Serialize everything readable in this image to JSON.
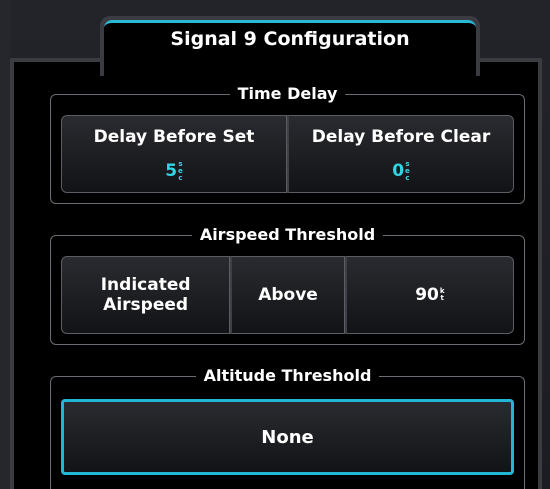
{
  "title": "Signal 9 Configuration",
  "time_delay": {
    "label": "Time Delay",
    "delay_before_set": {
      "label": "Delay Before Set",
      "value": "5",
      "unit_top": "s",
      "unit_mid": "e",
      "unit_bot": "c"
    },
    "delay_before_clear": {
      "label": "Delay Before Clear",
      "value": "0",
      "unit_top": "s",
      "unit_mid": "e",
      "unit_bot": "c"
    }
  },
  "airspeed_threshold": {
    "label": "Airspeed Threshold",
    "type_line1": "Indicated",
    "type_line2": "Airspeed",
    "condition": "Above",
    "value": "90",
    "unit_top": "k",
    "unit_bot": "t"
  },
  "altitude_threshold": {
    "label": "Altitude Threshold",
    "value": "None"
  },
  "colors": {
    "accent": "#21b5d6",
    "value_text": "#2fd6e6",
    "background": "#000000"
  }
}
